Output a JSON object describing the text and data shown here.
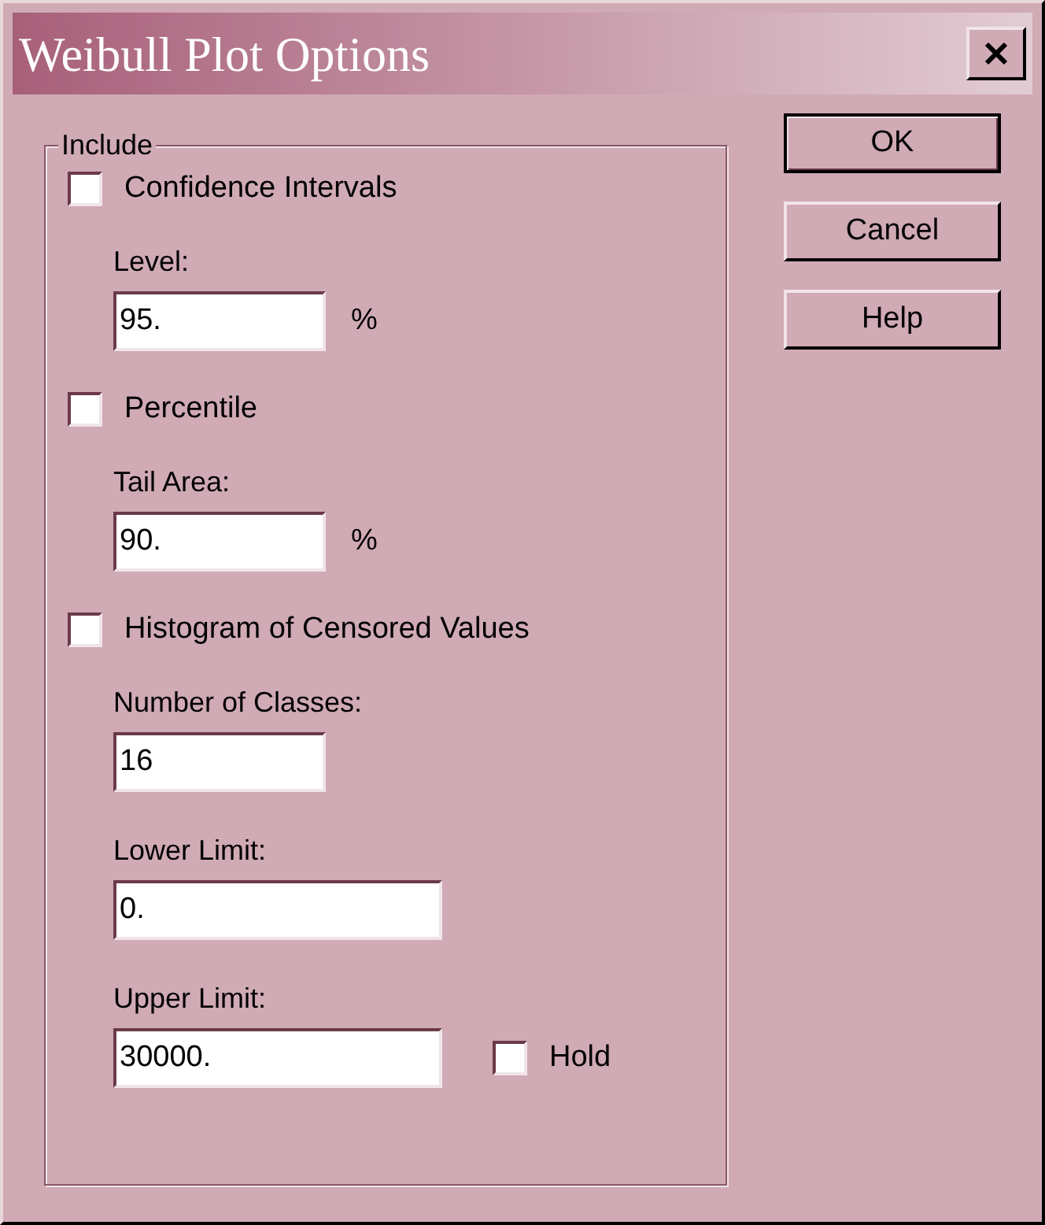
{
  "window": {
    "title": "Weibull Plot Options"
  },
  "group": {
    "label": "Include",
    "items": [
      {
        "kind": "checkbox",
        "label": "Confidence Intervals",
        "checked": false
      },
      {
        "kind": "field",
        "label": "Level:",
        "value": "95.",
        "unit": "%"
      },
      {
        "kind": "checkbox",
        "label": "Percentile",
        "checked": false
      },
      {
        "kind": "field",
        "label": "Tail Area:",
        "value": "90.",
        "unit": "%"
      },
      {
        "kind": "checkbox",
        "label": "Histogram of Censored Values",
        "checked": false
      },
      {
        "kind": "field",
        "label": "Number of Classes:",
        "value": "16"
      },
      {
        "kind": "wide_field",
        "label": "Lower Limit:",
        "value": "0."
      },
      {
        "kind": "wide_field",
        "label": "Upper Limit:",
        "value": "30000.",
        "hold": {
          "label": "Hold",
          "checked": false
        }
      }
    ]
  },
  "buttons": [
    {
      "label": "OK",
      "default": true
    },
    {
      "label": "Cancel",
      "default": false
    },
    {
      "label": "Help",
      "default": false
    }
  ]
}
